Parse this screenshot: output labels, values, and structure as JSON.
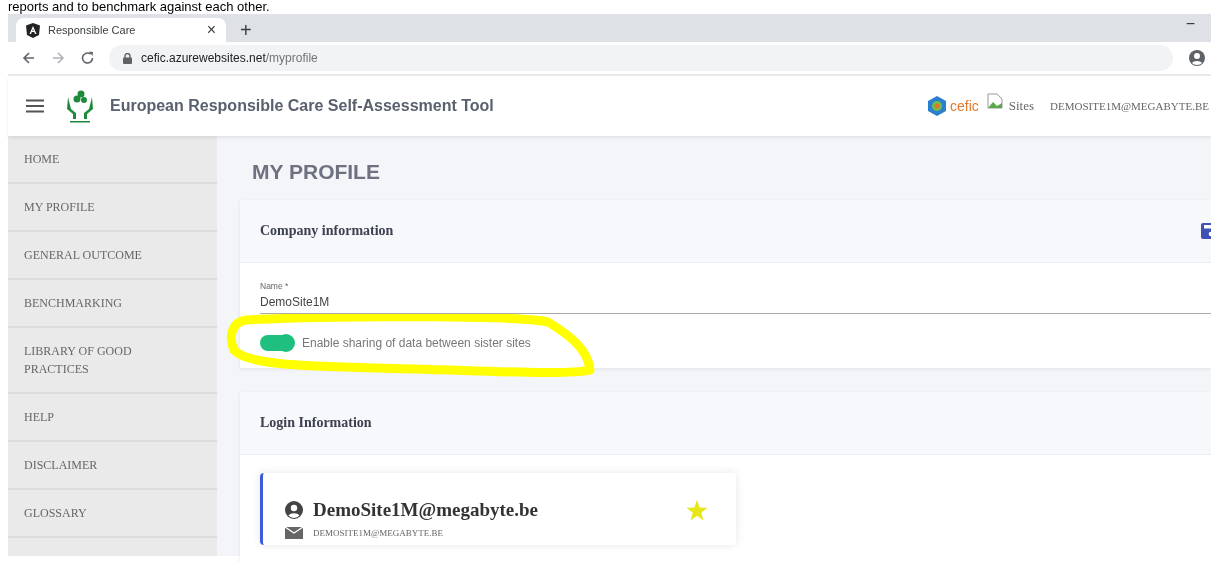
{
  "caption": "reports and to benchmark against each other.",
  "browser": {
    "tab_title": "Responsible Care",
    "tab_close": "×",
    "new_tab": "+",
    "minimize": "−",
    "url_host": "cefic.azurewebsites.net",
    "url_path": "/myprofile"
  },
  "header": {
    "title": "European Responsible Care Self-Assessment Tool",
    "brand": "cefic",
    "sites": "Sites",
    "user": "DEMOSITE1M@MEGABYTE.BE"
  },
  "sidebar": {
    "items": [
      {
        "label": "HOME"
      },
      {
        "label": "MY PROFILE"
      },
      {
        "label": "GENERAL OUTCOME"
      },
      {
        "label": "BENCHMARKING"
      },
      {
        "label": "LIBRARY OF GOOD PRACTICES"
      },
      {
        "label": "HELP"
      },
      {
        "label": "DISCLAIMER"
      },
      {
        "label": "GLOSSARY"
      }
    ]
  },
  "page_title": "MY PROFILE",
  "company": {
    "title": "Company information",
    "name_label": "Name *",
    "name_value": "DemoSite1M",
    "toggle": {
      "label": "Enable sharing of data between sister sites",
      "on": true
    }
  },
  "login": {
    "title": "Login Information",
    "account": {
      "name": "DemoSite1M@megabyte.be",
      "email": "DEMOSITE1M@MEGABYTE.BE"
    }
  }
}
